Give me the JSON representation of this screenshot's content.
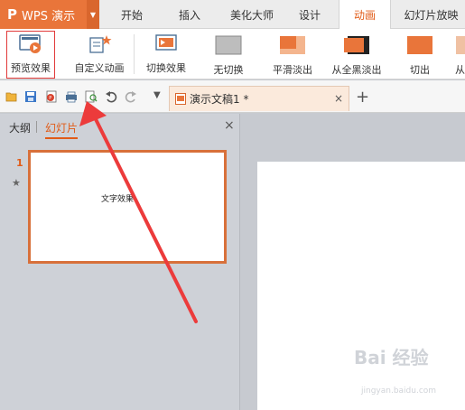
{
  "app": {
    "logo_prefix": "P",
    "title": "WPS 演示",
    "brand_color": "#e9753a"
  },
  "menu": {
    "tabs": [
      {
        "label": "开始",
        "active": false
      },
      {
        "label": "插入",
        "active": false
      },
      {
        "label": "美化大师",
        "active": false
      },
      {
        "label": "设计",
        "active": false
      },
      {
        "label": "动画",
        "active": true
      },
      {
        "label": "幻灯片放映",
        "active": false
      }
    ]
  },
  "ribbon": {
    "buttons": [
      {
        "label": "预览效果",
        "icon": "preview-play-icon"
      },
      {
        "label": "自定义动画",
        "icon": "custom-animation-icon"
      },
      {
        "label": "切换效果",
        "icon": "transition-effect-icon"
      },
      {
        "label": "无切换",
        "icon": "no-transition-icon"
      },
      {
        "label": "平滑淡出",
        "icon": "fade-smooth-icon"
      },
      {
        "label": "从全黑淡出",
        "icon": "fade-black-icon"
      },
      {
        "label": "切出",
        "icon": "cut-out-icon"
      },
      {
        "label": "从",
        "icon": "partial-icon"
      }
    ]
  },
  "quickbar": {
    "document_tab": "演示文稿1 *",
    "close_symbol": "×",
    "new_tab_symbol": "+"
  },
  "left_panel": {
    "tabs": [
      {
        "label": "大纲",
        "active": false
      },
      {
        "label": "幻灯片",
        "active": true
      }
    ],
    "close_symbol": "×",
    "slides": [
      {
        "number": "1",
        "text": "文字效果"
      }
    ]
  },
  "watermark": {
    "text": "Bai 经验",
    "sub": "jingyan.baidu.com"
  },
  "colors": {
    "accent": "#e15b17",
    "highlight_red": "#e23a3a",
    "arrow_red": "#ec3b3b"
  }
}
